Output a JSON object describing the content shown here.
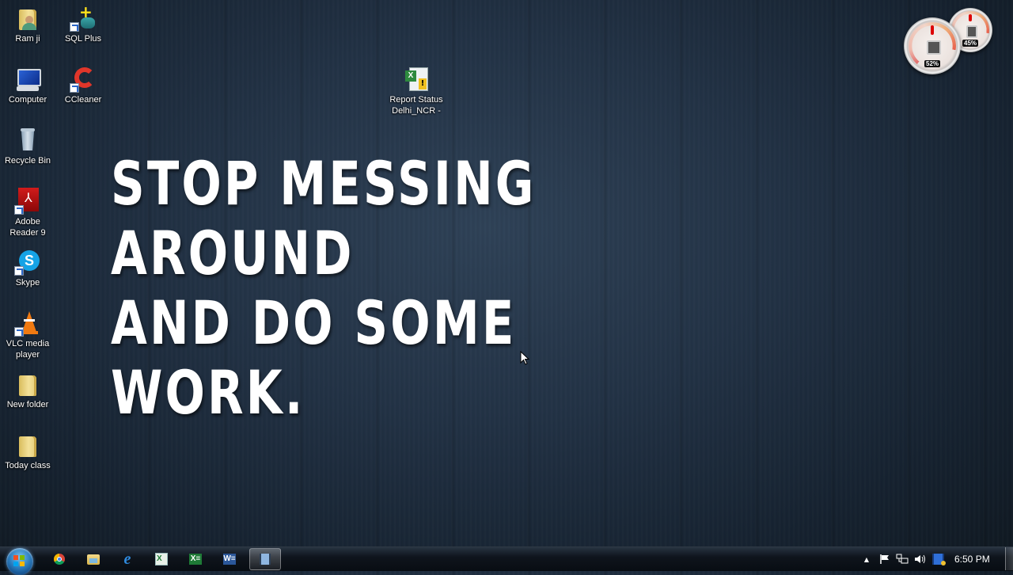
{
  "desktop": {
    "icons": [
      {
        "label": "Ram ji",
        "icon": "user-folder-icon"
      },
      {
        "label": "SQL Plus",
        "icon": "sql-plus-icon"
      },
      {
        "label": "Computer",
        "icon": "computer-icon"
      },
      {
        "label": "CCleaner",
        "icon": "ccleaner-icon"
      },
      {
        "label": "Recycle Bin",
        "icon": "recycle-bin-icon"
      },
      {
        "label": "Adobe Reader 9",
        "icon": "adobe-reader-icon"
      },
      {
        "label": "Skype",
        "icon": "skype-icon"
      },
      {
        "label": "VLC media player",
        "icon": "vlc-icon"
      },
      {
        "label": "New folder",
        "icon": "folder-icon"
      },
      {
        "label": "Today class",
        "icon": "folder-icon"
      },
      {
        "label": "Report Status Delhi_NCR -",
        "icon": "excel-file-icon"
      }
    ],
    "wallpaper_text": [
      "STOP MESSING",
      "AROUND",
      "AND DO SOME",
      "WORK."
    ]
  },
  "gadgets": {
    "cpu_meter": {
      "cpu_percent": "52%",
      "memory_percent": "45%"
    }
  },
  "taskbar": {
    "start": "start-orb",
    "pinned": [
      {
        "name": "chrome",
        "icon": "chrome-icon"
      },
      {
        "name": "windows-explorer",
        "icon": "explorer-icon"
      },
      {
        "name": "internet-explorer",
        "icon": "ie-icon"
      },
      {
        "name": "excel-file",
        "icon": "excel-icon"
      },
      {
        "name": "excel",
        "icon": "excel-icon"
      },
      {
        "name": "word",
        "icon": "word-icon"
      },
      {
        "name": "video-app",
        "icon": "film-icon",
        "active": true
      }
    ],
    "tray": {
      "show_hidden": "▲",
      "clock": "6:50 PM"
    }
  },
  "colors": {
    "wallpaper": "#223245",
    "taskbar": "#0e141c",
    "folder": "#f3e199"
  }
}
